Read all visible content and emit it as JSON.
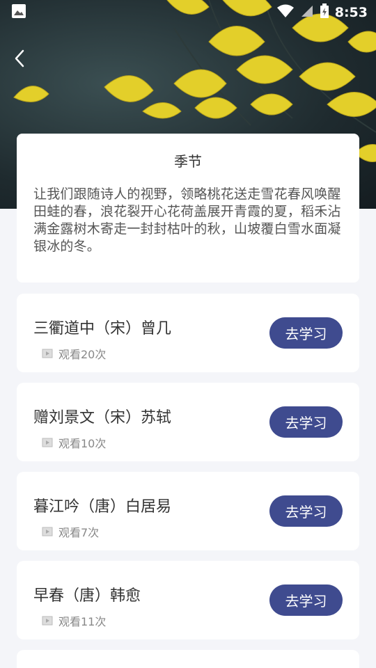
{
  "status": {
    "time": "8:53"
  },
  "intro": {
    "title": "季节",
    "text": "让我们跟随诗人的视野，领略桃花送走雪花春风唤醒田蛙的春，浪花裂开心花荷盖展开青霞的夏，稻禾沾满金露树木寄走一封封枯叶的秋，山坡覆白雪水面凝银冰的冬。"
  },
  "poems": [
    {
      "title": "三衢道中（宋）曾几",
      "views": "观看20次",
      "button": "去学习"
    },
    {
      "title": "赠刘景文（宋）苏轼",
      "views": "观看10次",
      "button": "去学习"
    },
    {
      "title": "暮江吟（唐）白居易",
      "views": "观看7次",
      "button": "去学习"
    },
    {
      "title": "早春（唐）韩愈",
      "views": "观看11次",
      "button": "去学习"
    }
  ],
  "colors": {
    "button": "#3f4b8f",
    "leaf": "#e3cf2a"
  }
}
